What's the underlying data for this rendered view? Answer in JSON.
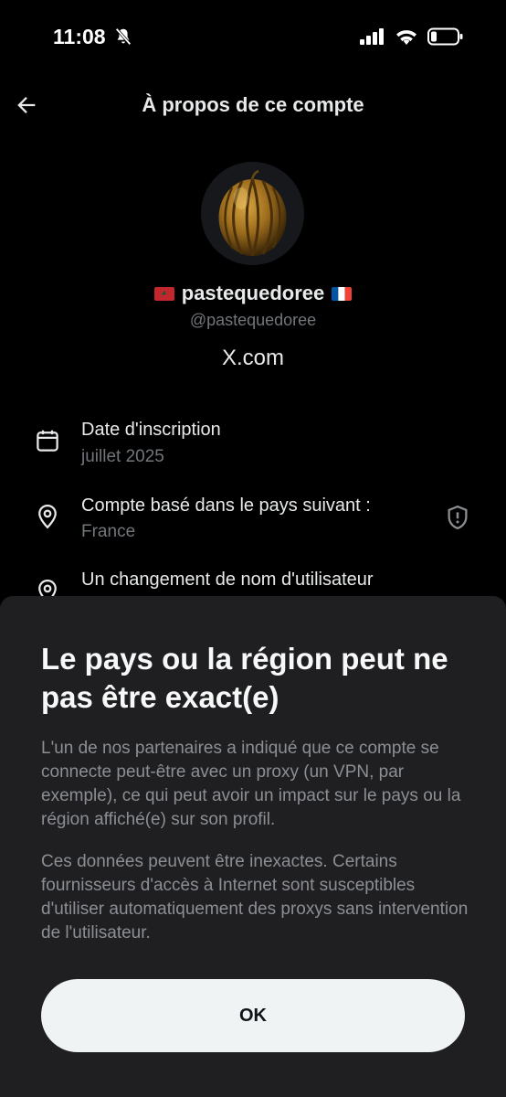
{
  "status_bar": {
    "time": "11:08"
  },
  "header": {
    "title": "À propos de ce compte"
  },
  "profile": {
    "display_name": "pastequedoree",
    "handle": "@pastequedoree",
    "site": "X.com"
  },
  "info": {
    "joined_label": "Date d'inscription",
    "joined_value": "juillet 2025",
    "country_label": "Compte basé dans le pays suivant :",
    "country_value": "France",
    "username_change_label": "Un changement de nom d'utilisateur"
  },
  "sheet": {
    "title": "Le pays ou la région peut ne pas être exact(e)",
    "paragraph1": "L'un de nos partenaires a indiqué que ce compte se connecte peut-être avec un proxy (un VPN, par exemple), ce qui peut avoir un impact sur le pays ou la région affiché(e) sur son profil.",
    "paragraph2": "Ces données peuvent être inexactes. Certains fournisseurs d'accès à Internet sont susceptibles d'utiliser automatiquement des proxys sans intervention de l'utilisateur.",
    "ok_label": "OK"
  },
  "icons": [
    "bell-slash-icon",
    "signal-icon",
    "wifi-icon",
    "battery-icon",
    "back-arrow-icon",
    "calendar-icon",
    "location-pin-icon",
    "shield-alert-icon"
  ]
}
